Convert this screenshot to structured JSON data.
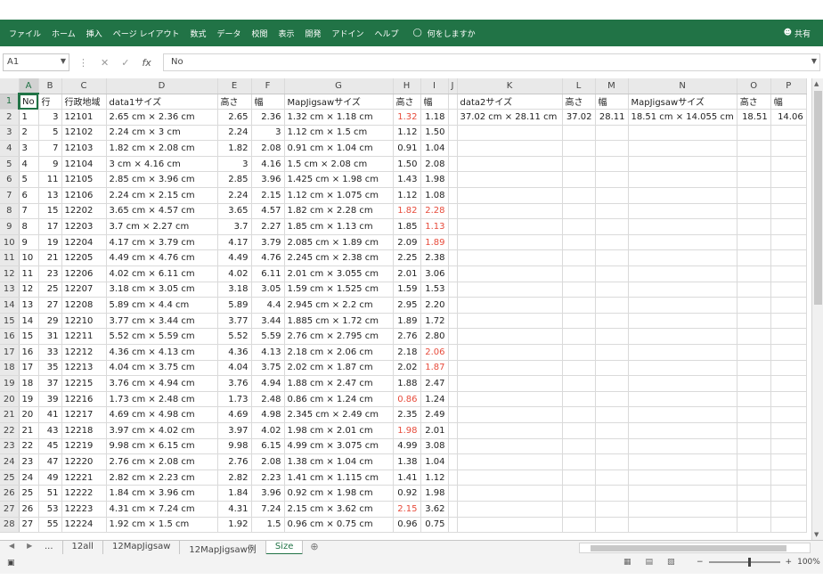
{
  "ribbon": {
    "tabs": [
      "ファイル",
      "ホーム",
      "挿入",
      "ページ レイアウト",
      "数式",
      "データ",
      "校閲",
      "表示",
      "開発",
      "アドイン",
      "ヘルプ"
    ],
    "tell_me": "何をしますか",
    "share": "共有"
  },
  "formula_bar": {
    "name_box": "A1",
    "value": "No"
  },
  "columns": [
    "A",
    "B",
    "C",
    "D",
    "E",
    "F",
    "G",
    "H",
    "I",
    "J",
    "K",
    "L",
    "M",
    "N",
    "O",
    "P"
  ],
  "rows": [
    {
      "n": "1",
      "c": [
        "No",
        "行",
        "行政地域",
        "data1サイズ",
        "高さ",
        "幅",
        "MapJigsawサイズ",
        "高さ",
        "幅",
        "",
        "data2サイズ",
        "高さ",
        "幅",
        "MapJigsawサイズ",
        "高さ",
        "幅"
      ]
    },
    {
      "n": "2",
      "c": [
        "1",
        "3",
        "12101",
        "2.65 cm × 2.36 cm",
        "2.65",
        "2.36",
        "1.32 cm × 1.18 cm",
        "1.32",
        "1.18",
        "",
        "37.02 cm × 28.11 cm",
        "37.02",
        "28.11",
        "18.51 cm × 14.055 cm",
        "18.51",
        "14.06"
      ],
      "r": [
        7
      ]
    },
    {
      "n": "3",
      "c": [
        "2",
        "5",
        "12102",
        "2.24 cm × 3 cm",
        "2.24",
        "3",
        "1.12 cm × 1.5 cm",
        "1.12",
        "1.50",
        "",
        "",
        "",
        "",
        "",
        "",
        ""
      ]
    },
    {
      "n": "4",
      "c": [
        "3",
        "7",
        "12103",
        "1.82 cm × 2.08 cm",
        "1.82",
        "2.08",
        "0.91 cm × 1.04 cm",
        "0.91",
        "1.04",
        "",
        "",
        "",
        "",
        "",
        "",
        ""
      ]
    },
    {
      "n": "5",
      "c": [
        "4",
        "9",
        "12104",
        "3 cm × 4.16 cm",
        "3",
        "4.16",
        "1.5 cm × 2.08 cm",
        "1.50",
        "2.08",
        "",
        "",
        "",
        "",
        "",
        "",
        ""
      ]
    },
    {
      "n": "6",
      "c": [
        "5",
        "11",
        "12105",
        "2.85 cm × 3.96 cm",
        "2.85",
        "3.96",
        "1.425 cm × 1.98 cm",
        "1.43",
        "1.98",
        "",
        "",
        "",
        "",
        "",
        "",
        ""
      ]
    },
    {
      "n": "7",
      "c": [
        "6",
        "13",
        "12106",
        "2.24 cm × 2.15 cm",
        "2.24",
        "2.15",
        "1.12 cm × 1.075 cm",
        "1.12",
        "1.08",
        "",
        "",
        "",
        "",
        "",
        "",
        ""
      ]
    },
    {
      "n": "8",
      "c": [
        "7",
        "15",
        "12202",
        "3.65 cm × 4.57 cm",
        "3.65",
        "4.57",
        "1.82 cm × 2.28 cm",
        "1.82",
        "2.28",
        "",
        "",
        "",
        "",
        "",
        "",
        ""
      ],
      "r": [
        7,
        8
      ]
    },
    {
      "n": "9",
      "c": [
        "8",
        "17",
        "12203",
        "3.7 cm × 2.27 cm",
        "3.7",
        "2.27",
        "1.85 cm × 1.13 cm",
        "1.85",
        "1.13",
        "",
        "",
        "",
        "",
        "",
        "",
        ""
      ],
      "r": [
        8
      ]
    },
    {
      "n": "10",
      "c": [
        "9",
        "19",
        "12204",
        "4.17 cm × 3.79 cm",
        "4.17",
        "3.79",
        "2.085 cm × 1.89 cm",
        "2.09",
        "1.89",
        "",
        "",
        "",
        "",
        "",
        "",
        ""
      ],
      "r": [
        8
      ]
    },
    {
      "n": "11",
      "c": [
        "10",
        "21",
        "12205",
        "4.49 cm × 4.76 cm",
        "4.49",
        "4.76",
        "2.245 cm × 2.38 cm",
        "2.25",
        "2.38",
        "",
        "",
        "",
        "",
        "",
        "",
        ""
      ]
    },
    {
      "n": "12",
      "c": [
        "11",
        "23",
        "12206",
        "4.02 cm × 6.11 cm",
        "4.02",
        "6.11",
        "2.01 cm × 3.055 cm",
        "2.01",
        "3.06",
        "",
        "",
        "",
        "",
        "",
        "",
        ""
      ]
    },
    {
      "n": "13",
      "c": [
        "12",
        "25",
        "12207",
        "3.18 cm × 3.05 cm",
        "3.18",
        "3.05",
        "1.59 cm × 1.525 cm",
        "1.59",
        "1.53",
        "",
        "",
        "",
        "",
        "",
        "",
        ""
      ]
    },
    {
      "n": "14",
      "c": [
        "13",
        "27",
        "12208",
        "5.89 cm × 4.4 cm",
        "5.89",
        "4.4",
        "2.945 cm × 2.2 cm",
        "2.95",
        "2.20",
        "",
        "",
        "",
        "",
        "",
        "",
        ""
      ]
    },
    {
      "n": "15",
      "c": [
        "14",
        "29",
        "12210",
        "3.77 cm × 3.44 cm",
        "3.77",
        "3.44",
        "1.885 cm × 1.72 cm",
        "1.89",
        "1.72",
        "",
        "",
        "",
        "",
        "",
        "",
        ""
      ]
    },
    {
      "n": "16",
      "c": [
        "15",
        "31",
        "12211",
        "5.52 cm × 5.59 cm",
        "5.52",
        "5.59",
        "2.76 cm × 2.795 cm",
        "2.76",
        "2.80",
        "",
        "",
        "",
        "",
        "",
        "",
        ""
      ]
    },
    {
      "n": "17",
      "c": [
        "16",
        "33",
        "12212",
        "4.36 cm × 4.13 cm",
        "4.36",
        "4.13",
        "2.18 cm × 2.06 cm",
        "2.18",
        "2.06",
        "",
        "",
        "",
        "",
        "",
        "",
        ""
      ],
      "r": [
        8
      ]
    },
    {
      "n": "18",
      "c": [
        "17",
        "35",
        "12213",
        "4.04 cm × 3.75 cm",
        "4.04",
        "3.75",
        "2.02 cm × 1.87 cm",
        "2.02",
        "1.87",
        "",
        "",
        "",
        "",
        "",
        "",
        ""
      ],
      "r": [
        8
      ]
    },
    {
      "n": "19",
      "c": [
        "18",
        "37",
        "12215",
        "3.76 cm × 4.94 cm",
        "3.76",
        "4.94",
        "1.88 cm × 2.47 cm",
        "1.88",
        "2.47",
        "",
        "",
        "",
        "",
        "",
        "",
        ""
      ]
    },
    {
      "n": "20",
      "c": [
        "19",
        "39",
        "12216",
        "1.73 cm × 2.48 cm",
        "1.73",
        "2.48",
        "0.86 cm × 1.24 cm",
        "0.86",
        "1.24",
        "",
        "",
        "",
        "",
        "",
        "",
        ""
      ],
      "r": [
        7
      ]
    },
    {
      "n": "21",
      "c": [
        "20",
        "41",
        "12217",
        "4.69 cm × 4.98 cm",
        "4.69",
        "4.98",
        "2.345 cm × 2.49 cm",
        "2.35",
        "2.49",
        "",
        "",
        "",
        "",
        "",
        "",
        ""
      ]
    },
    {
      "n": "22",
      "c": [
        "21",
        "43",
        "12218",
        "3.97 cm × 4.02 cm",
        "3.97",
        "4.02",
        "1.98 cm × 2.01 cm",
        "1.98",
        "2.01",
        "",
        "",
        "",
        "",
        "",
        "",
        ""
      ],
      "r": [
        7
      ]
    },
    {
      "n": "23",
      "c": [
        "22",
        "45",
        "12219",
        "9.98 cm × 6.15 cm",
        "9.98",
        "6.15",
        "4.99 cm × 3.075 cm",
        "4.99",
        "3.08",
        "",
        "",
        "",
        "",
        "",
        "",
        ""
      ]
    },
    {
      "n": "24",
      "c": [
        "23",
        "47",
        "12220",
        "2.76 cm × 2.08 cm",
        "2.76",
        "2.08",
        "1.38 cm × 1.04 cm",
        "1.38",
        "1.04",
        "",
        "",
        "",
        "",
        "",
        "",
        ""
      ]
    },
    {
      "n": "25",
      "c": [
        "24",
        "49",
        "12221",
        "2.82 cm × 2.23 cm",
        "2.82",
        "2.23",
        "1.41 cm × 1.115 cm",
        "1.41",
        "1.12",
        "",
        "",
        "",
        "",
        "",
        "",
        ""
      ]
    },
    {
      "n": "26",
      "c": [
        "25",
        "51",
        "12222",
        "1.84 cm × 3.96 cm",
        "1.84",
        "3.96",
        "0.92 cm × 1.98 cm",
        "0.92",
        "1.98",
        "",
        "",
        "",
        "",
        "",
        "",
        ""
      ]
    },
    {
      "n": "27",
      "c": [
        "26",
        "53",
        "12223",
        "4.31 cm × 7.24 cm",
        "4.31",
        "7.24",
        "2.15 cm × 3.62 cm",
        "2.15",
        "3.62",
        "",
        "",
        "",
        "",
        "",
        "",
        ""
      ],
      "r": [
        7
      ]
    },
    {
      "n": "28",
      "c": [
        "27",
        "55",
        "12224",
        "1.92 cm × 1.5 cm",
        "1.92",
        "1.5",
        "0.96 cm × 0.75 cm",
        "0.96",
        "0.75",
        "",
        "",
        "",
        "",
        "",
        "",
        ""
      ]
    }
  ],
  "sheet_tabs": [
    "...",
    "12all",
    "12MapJigsaw",
    "12MapJigsaw例",
    "Size"
  ],
  "active_sheet": "Size",
  "zoom": "100%",
  "colors": {
    "excel_green": "#217346",
    "red_text": "#e74c3c"
  }
}
